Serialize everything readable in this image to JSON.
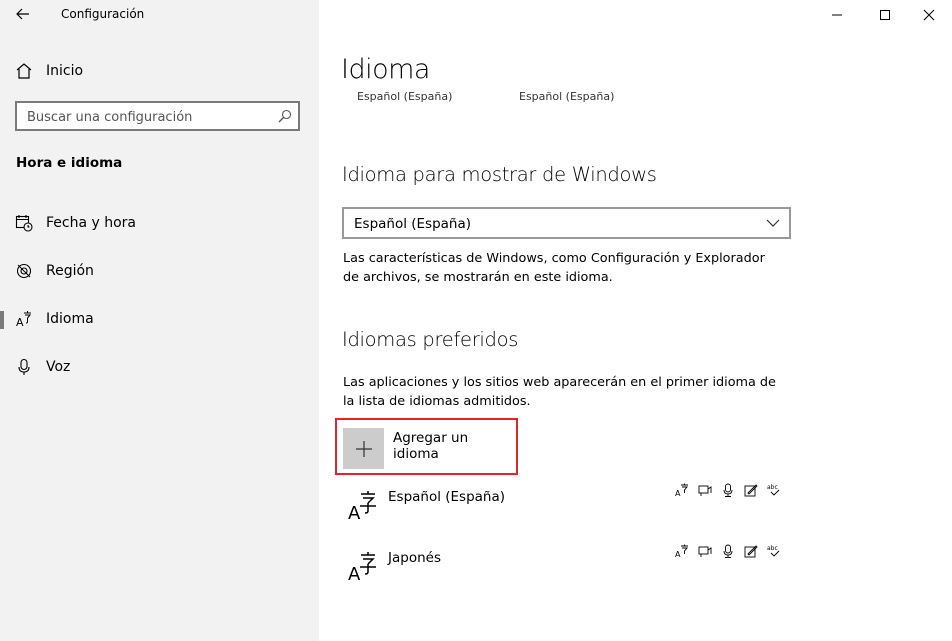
{
  "window": {
    "title": "Configuración",
    "controls": [
      "minimize",
      "maximize",
      "close"
    ]
  },
  "sidebar": {
    "home_label": "Inicio",
    "search": {
      "placeholder": "Buscar una configuración"
    },
    "section_heading": "Hora e idioma",
    "items": [
      {
        "label": "Fecha y hora",
        "icon": "calendar-clock-icon",
        "active": false
      },
      {
        "label": "Región",
        "icon": "globe-icon",
        "active": false
      },
      {
        "label": "Idioma",
        "icon": "language-icon",
        "active": true
      },
      {
        "label": "Voz",
        "icon": "microphone-icon",
        "active": false
      }
    ]
  },
  "main": {
    "title": "Idioma",
    "cropped_labels": [
      "Español (España)",
      "Español (España)"
    ],
    "display_language": {
      "heading": "Idioma para mostrar de Windows",
      "selected": "Español (España)",
      "description": "Las características de Windows, como Configuración y Explorador de archivos, se mostrarán en este idioma."
    },
    "preferred": {
      "heading": "Idiomas preferidos",
      "description": "Las aplicaciones y los sitios web aparecerán en el primer idioma de la lista de idiomas admitidos.",
      "add_label": "Agregar un idioma",
      "languages": [
        {
          "name": "Español (España)"
        },
        {
          "name": "Japonés"
        }
      ],
      "feature_icons": [
        "display-language-icon",
        "speech-icon",
        "microphone-icon",
        "handwriting-icon",
        "spellcheck-icon"
      ],
      "feature_glyph_text": "abc"
    }
  },
  "colors": {
    "sidebar_bg": "#f2f2f2",
    "highlight_border": "#e0262d",
    "plus_tile": "#cccccc"
  }
}
